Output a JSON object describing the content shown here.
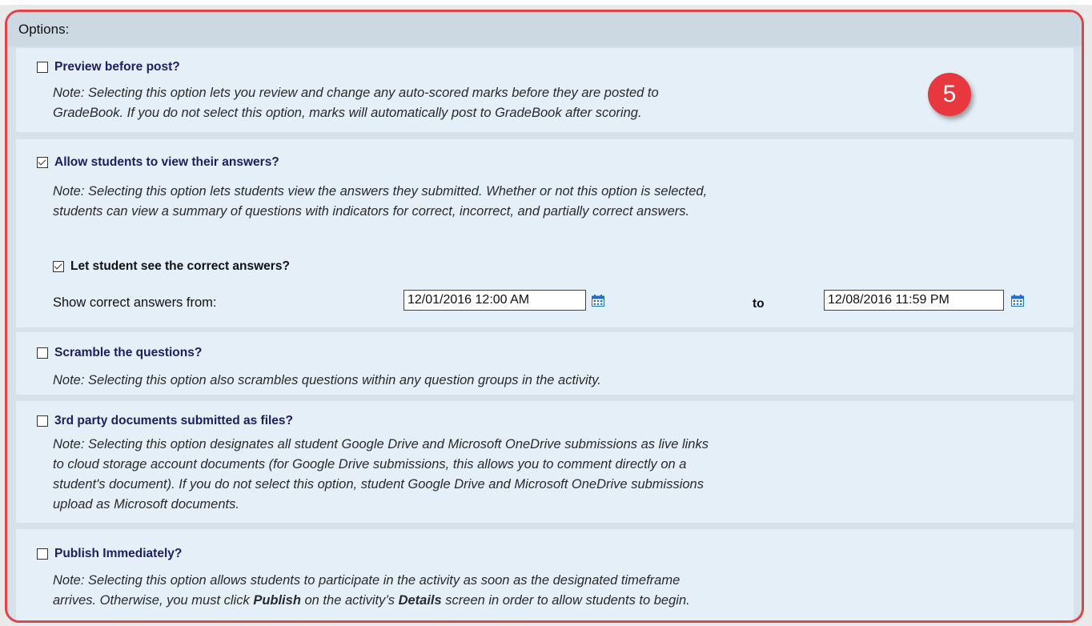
{
  "header": {
    "title": "Options:"
  },
  "step_badge": "5",
  "options": {
    "preview": {
      "label": "Preview before post?",
      "checked": false,
      "note": [
        "Note: Selecting this option lets you review and change any auto-scored marks before they are posted to",
        "GradeBook. If you do not select this option, marks will automatically post to GradeBook after scoring."
      ]
    },
    "view_answers": {
      "label": "Allow students to view their answers?",
      "checked": true,
      "note": [
        "Note: Selecting this option lets students view the answers they submitted. Whether or not this option is selected,",
        "students can view a summary of questions with indicators for correct, incorrect, and partially correct answers."
      ],
      "correct_answers": {
        "label": "Let student see the correct answers?",
        "checked": true,
        "show_from_label": "Show correct answers from:",
        "from_value": "12/01/2016 12:00 AM",
        "to_label": "to",
        "to_value": "12/08/2016 11:59 PM"
      }
    },
    "scramble": {
      "label": "Scramble the questions?",
      "checked": false,
      "note": [
        "Note: Selecting this option also scrambles questions within any question groups in the activity."
      ]
    },
    "third_party": {
      "label": "3rd party documents submitted as files?",
      "checked": false,
      "note": [
        "Note: Selecting this option designates all student Google Drive and Microsoft OneDrive submissions as live links",
        "to cloud storage account documents (for Google Drive submissions, this allows you to comment directly on a",
        "student's document). If you do not select this option, student Google Drive and  Microsoft OneDrive submissions",
        "upload as Microsoft documents."
      ]
    },
    "publish": {
      "label": "Publish Immediately?",
      "checked": false,
      "note_line1": "Note: Selecting this option allows students to participate in the activity as soon as the designated timeframe",
      "note_line2_a": "arrives. Otherwise, you must click ",
      "note_line2_b": "Publish",
      "note_line2_c": " on the activity’s ",
      "note_line2_d": "Details",
      "note_line2_e": " screen in order to allow students to begin."
    }
  },
  "colors": {
    "frame": "#e0434a",
    "badge": "#e8383f",
    "label": "#1c2060",
    "section_bg": "#e5eff7",
    "header_bg": "#ccd9e3",
    "calendar": "#1f6fc5"
  },
  "icons": [
    "calendar-icon",
    "calendar-icon"
  ]
}
